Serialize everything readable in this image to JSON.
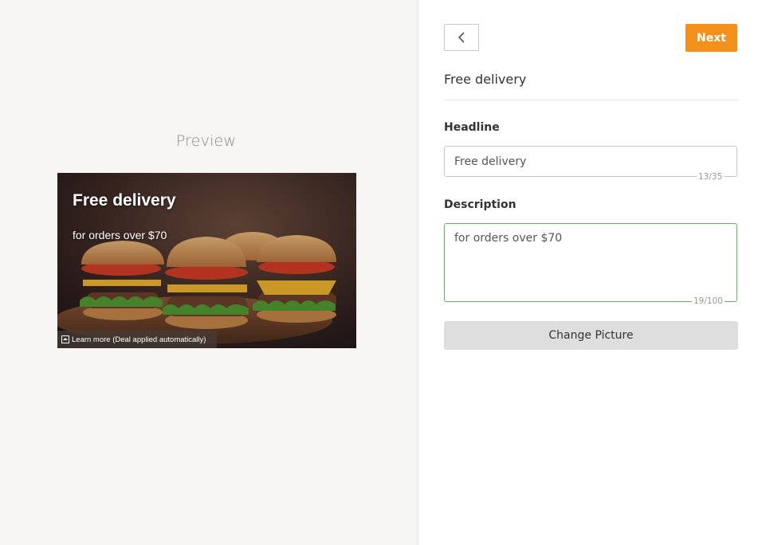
{
  "preview": {
    "title": "Preview",
    "ad": {
      "headline": "Free delivery",
      "description": "for orders over $70",
      "learn_more": "Learn more (Deal applied automatically)"
    }
  },
  "toolbar": {
    "back_icon": "chevron-left-icon",
    "next_label": "Next",
    "accent_color": "#f39019"
  },
  "form": {
    "title": "Free delivery",
    "headline": {
      "label": "Headline",
      "value": "Free delivery",
      "counter": "13/35"
    },
    "description": {
      "label": "Description",
      "value": "for orders over $70",
      "counter": "19/100"
    },
    "change_picture_label": "Change Picture"
  }
}
